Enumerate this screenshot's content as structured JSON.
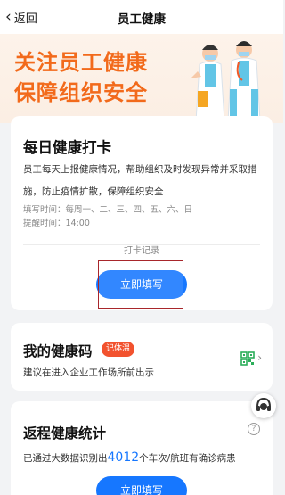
{
  "nav": {
    "back_label": "返回",
    "title": "员工健康"
  },
  "banner": {
    "line1": "关注员工健康",
    "line2": "保障组织安全"
  },
  "checkin": {
    "title": "每日健康打卡",
    "desc": "员工每天上报健康情况，帮助组织及时发现异常并采取措施，防止疫情扩散，保障组织安全",
    "fill_time": "填写时间：每周一、二、三、四、五、六、日",
    "remind_time": "提醒时间：14:00",
    "record_label": "打卡记录",
    "button": "立即填写"
  },
  "health_code": {
    "title": "我的健康码",
    "badge": "记体温",
    "sub": "建议在进入企业工作场所前出示"
  },
  "return_stats": {
    "title": "返程健康统计",
    "sub_prefix": "已通过大数据识别出",
    "count": "4012",
    "sub_suffix": "个车次/航班有确诊病患",
    "button": "立即填写",
    "help_icon": "?"
  },
  "colors": {
    "accent": "#1677ff",
    "banner_text": "#f26a1b",
    "badge": "#f2522e",
    "highlight_box": "#a8262b"
  },
  "icons": [
    "chevron-left-icon",
    "doctors-illustration",
    "qr-code-icon",
    "chevron-right-icon",
    "help-icon",
    "support-avatar-icon"
  ]
}
